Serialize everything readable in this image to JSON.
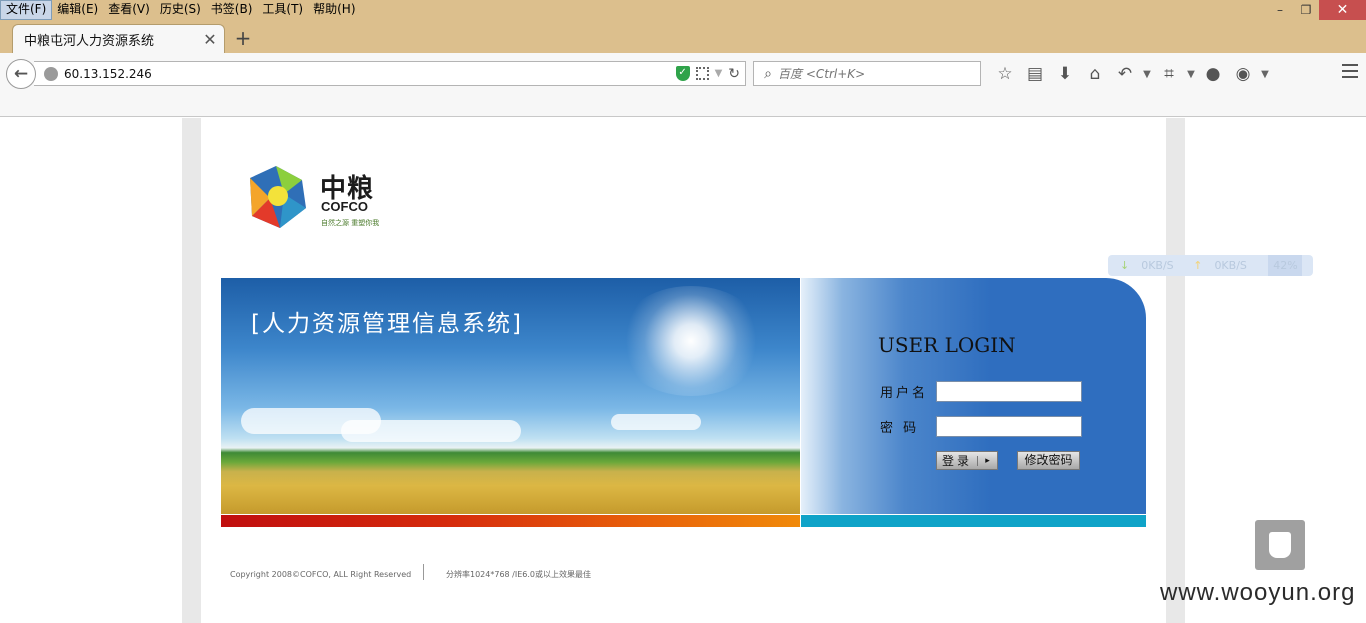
{
  "menubar": {
    "items": [
      "文件(F)",
      "编辑(E)",
      "查看(V)",
      "历史(S)",
      "书签(B)",
      "工具(T)",
      "帮助(H)"
    ]
  },
  "window_controls": {
    "minimize": "–",
    "restore": "❐",
    "close": "✕"
  },
  "tab": {
    "title": "中粮屯河人力资源系统",
    "close": "✕",
    "new_tab": "+"
  },
  "navbar": {
    "back": "←",
    "url": "60.13.152.246",
    "search_placeholder": "百度 <Ctrl+K>"
  },
  "page": {
    "logo": {
      "cn": "中粮",
      "en": "COFCO",
      "slogan": "自然之源 重塑你我"
    },
    "speed": {
      "down": "0KB/S",
      "up": "0KB/S",
      "percent": "42%"
    },
    "banner_title": "[人力资源管理信息系统]",
    "login": {
      "heading": "USER LOGIN",
      "username_label": "用户名",
      "password_label": "密 码",
      "username_value": "",
      "password_value": "",
      "login_button": "登录",
      "change_password_button": "修改密码"
    },
    "footer": {
      "copyright": "Copyright 2008©COFCO, ALL Right Reserved",
      "resolution": "分辨率1024*768 /IE6.0或以上效果最佳"
    },
    "watermark": "www.wooyun.org"
  },
  "colors": {
    "titlebar": "#dcbf8d",
    "login_panel": "#2f6ebf",
    "accent_bar_red": "#c00e0e",
    "accent_bar_teal": "#0fa3c8"
  }
}
